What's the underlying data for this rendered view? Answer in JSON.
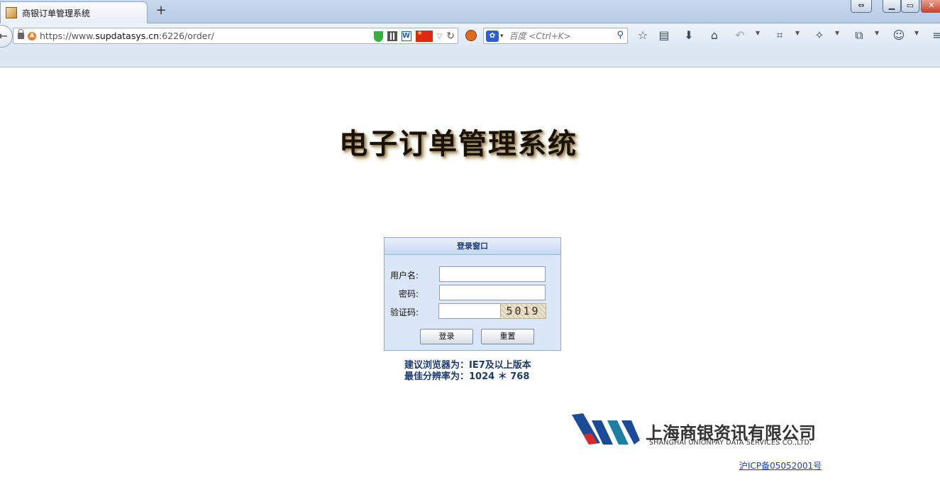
{
  "browser": {
    "tab_title": "商银订单管理系统",
    "new_tab_label": "+",
    "url_prefix": "https://www.",
    "url_domain": "supdatasys.cn",
    "url_suffix": ":6226/order/",
    "search_placeholder": "百度 <Ctrl+K>",
    "window_buttons": [
      "⇔",
      "▁",
      "▭",
      "✕"
    ],
    "toolbar_icons": [
      "star-icon",
      "reading-list-icon",
      "download-icon",
      "home-icon",
      "undo-icon",
      "crop-icon",
      "gesture-icon",
      "share-icon",
      "avatar-icon",
      "menu-icon"
    ]
  },
  "page": {
    "title": "电子订单管理系统"
  },
  "login": {
    "header": "登录窗口",
    "username_label": "用户名:",
    "password_label": "密码:",
    "captcha_label": "验证码:",
    "username_value": "",
    "password_value": "",
    "captcha_value": "",
    "captcha_code": "5019",
    "login_button": "登录",
    "reset_button": "重置"
  },
  "tips": {
    "browser": "建议浏览器为：IE7及以上版本",
    "resolution": "最佳分辨率为：1024 ＊ 768"
  },
  "footer": {
    "company_cn": "上海商银资讯有限公司",
    "company_en": "SHANGHAI UNIONPAY DATA SERVICES CO.,LTD.",
    "icp": "沪ICP备05052001号"
  },
  "colors": {
    "logo_red": "#d42a2a",
    "logo_blue": "#1b4a96",
    "logo_teal": "#1f7fa3",
    "tips_text": "#1c3a70",
    "link": "#1a3fb4"
  }
}
